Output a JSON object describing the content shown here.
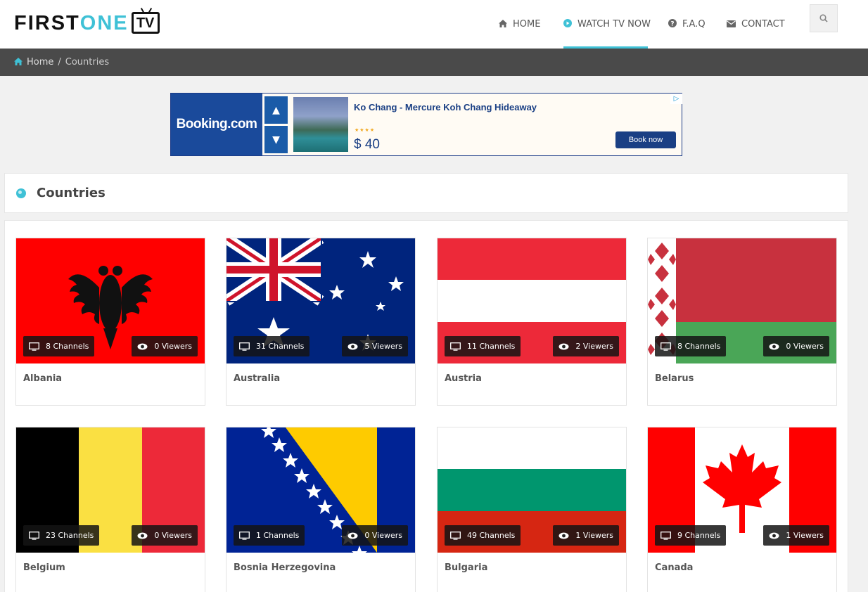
{
  "header": {
    "logo": {
      "first": "FIRST",
      "one": "ONE",
      "tv": "TV"
    },
    "nav": [
      {
        "label": "HOME",
        "icon": "home-icon"
      },
      {
        "label": "WATCH TV NOW",
        "icon": "play-circle-icon",
        "active": true
      },
      {
        "label": "F.A.Q",
        "icon": "question-circle-icon"
      },
      {
        "label": "CONTACT",
        "icon": "envelope-icon"
      }
    ],
    "search_icon": "search-icon"
  },
  "breadcrumb": {
    "home": "Home",
    "separator": "/",
    "current": "Countries"
  },
  "ad": {
    "brand": "Booking.com",
    "title": "Ko Chang - Mercure Koh Chang Hideaway",
    "stars": "★★★★",
    "price": "$ 40",
    "button": "Book now"
  },
  "section": {
    "title": "Countries",
    "icon": "globe-icon"
  },
  "countries": [
    {
      "name": "Albania",
      "channels": "8 Channels",
      "viewers": "0 Viewers"
    },
    {
      "name": "Australia",
      "channels": "31 Channels",
      "viewers": "5 Viewers"
    },
    {
      "name": "Austria",
      "channels": "11 Channels",
      "viewers": "2 Viewers"
    },
    {
      "name": "Belarus",
      "channels": "8 Channels",
      "viewers": "0 Viewers"
    },
    {
      "name": "Belgium",
      "channels": "23 Channels",
      "viewers": "0 Viewers"
    },
    {
      "name": "Bosnia Herzegovina",
      "channels": "1 Channels",
      "viewers": "0 Viewers"
    },
    {
      "name": "Bulgaria",
      "channels": "49 Channels",
      "viewers": "1 Viewers"
    },
    {
      "name": "Canada",
      "channels": "9 Channels",
      "viewers": "1 Viewers"
    }
  ],
  "colors": {
    "accent": "#3fc1d6",
    "breadcrumb_bg": "#4a4a4a"
  }
}
